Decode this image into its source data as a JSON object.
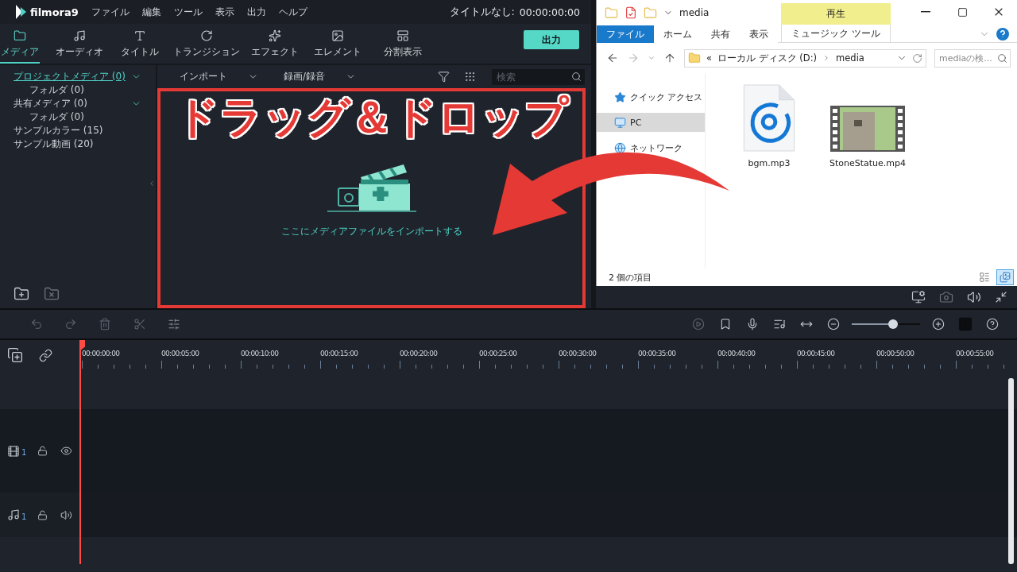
{
  "app": {
    "logo": "filmora9",
    "menu": [
      "ファイル",
      "編集",
      "ツール",
      "表示",
      "出力",
      "ヘルプ"
    ],
    "project_title": "タイトルなし:",
    "timecode": "00:00:00:00"
  },
  "tabs": [
    {
      "label": "メディア",
      "kind": "media",
      "selected": true
    },
    {
      "label": "オーディオ",
      "kind": "audio",
      "selected": false
    },
    {
      "label": "タイトル",
      "kind": "title",
      "selected": false
    },
    {
      "label": "トランジション",
      "kind": "transition",
      "selected": false
    },
    {
      "label": "エフェクト",
      "kind": "effect",
      "selected": false
    },
    {
      "label": "エレメント",
      "kind": "element",
      "selected": false
    },
    {
      "label": "分割表示",
      "kind": "split",
      "selected": false
    }
  ],
  "export_button": "出力",
  "sidebar": {
    "items": [
      {
        "label": "プロジェクトメディア (0)",
        "selected": true,
        "expanded": true,
        "children": [
          {
            "label": "フォルダ (0)",
            "selected": false
          }
        ]
      },
      {
        "label": "共有メディア (0)",
        "selected": false,
        "expanded": true,
        "children": [
          {
            "label": "フォルダ (0)",
            "selected": false
          }
        ]
      },
      {
        "label": "サンプルカラー (15)",
        "selected": false
      },
      {
        "label": "サンプル動画 (20)",
        "selected": false
      }
    ]
  },
  "media_toolbar": {
    "import": "インポート",
    "record": "録画/録音",
    "search_placeholder": "検索"
  },
  "annotation": "ドラッグ＆ドロップ",
  "drop_hint": "ここにメディアファイルをインポートする",
  "explorer": {
    "title": "media",
    "ribbon_tabs": [
      {
        "label": "ファイル",
        "kind": "file"
      },
      {
        "label": "ホーム",
        "kind": "plain"
      },
      {
        "label": "共有",
        "kind": "plain"
      },
      {
        "label": "表示",
        "kind": "plain"
      },
      {
        "label": "ミュージック ツール",
        "kind": "context",
        "group": "再生"
      }
    ],
    "path_prefix": "«",
    "path": [
      "ローカル ディスク (D:)",
      "media"
    ],
    "search_placeholder": "mediaの検...",
    "nav": [
      {
        "label": "クイック アクセス",
        "kind": "quick",
        "selected": false
      },
      {
        "label": "PC",
        "kind": "pc",
        "selected": true
      },
      {
        "label": "ネットワーク",
        "kind": "network",
        "selected": false
      }
    ],
    "files": [
      {
        "name": "bgm.mp3",
        "kind": "audio"
      },
      {
        "name": "StoneStatue.mp4",
        "kind": "video"
      }
    ],
    "status": "2 個の項目"
  },
  "timeline": {
    "ruler": [
      "00:00:00:00",
      "00:00:05:00",
      "00:00:10:00",
      "00:00:15:00",
      "00:00:20:00",
      "00:00:25:00",
      "00:00:30:00",
      "00:00:35:00",
      "00:00:40:00",
      "00:00:45:00",
      "00:00:50:00",
      "00:00:55:00"
    ],
    "zoom": {
      "level": 0.6
    },
    "tracks": [
      {
        "kind": "video",
        "number": "1"
      },
      {
        "kind": "audio",
        "number": "1"
      }
    ]
  }
}
